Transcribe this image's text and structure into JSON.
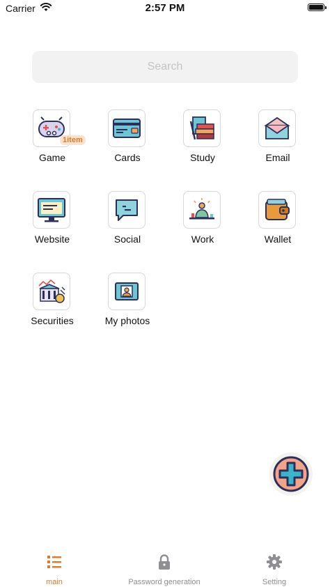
{
  "status_bar": {
    "carrier": "Carrier",
    "time": "2:57 PM",
    "wifi_icon": "wifi-icon",
    "battery_icon": "battery-icon",
    "battery_level": 1.0
  },
  "search": {
    "placeholder": "Search"
  },
  "categories": [
    {
      "label": "Game",
      "icon": "gamepad-icon",
      "badge": "1item"
    },
    {
      "label": "Cards",
      "icon": "credit-card-icon"
    },
    {
      "label": "Study",
      "icon": "books-icon"
    },
    {
      "label": "Email",
      "icon": "envelope-icon"
    },
    {
      "label": "Website",
      "icon": "monitor-icon"
    },
    {
      "label": "Social",
      "icon": "chat-bubble-icon"
    },
    {
      "label": "Work",
      "icon": "person-at-desk-icon"
    },
    {
      "label": "Wallet",
      "icon": "wallet-icon"
    },
    {
      "label": "Securities",
      "icon": "bank-chart-icon"
    },
    {
      "label": "My photos",
      "icon": "photo-id-icon"
    }
  ],
  "fab": {
    "icon": "plus-icon"
  },
  "tab_bar": {
    "tabs": [
      {
        "label": "main",
        "icon": "list-icon",
        "active": true
      },
      {
        "label": "Password generation",
        "icon": "lock-icon",
        "active": false
      },
      {
        "label": "Setting",
        "icon": "gear-icon",
        "active": false
      }
    ]
  },
  "colors": {
    "accent": "#e07a2c",
    "inactive": "#8e8e93",
    "search_bg": "#f2f2f3"
  }
}
